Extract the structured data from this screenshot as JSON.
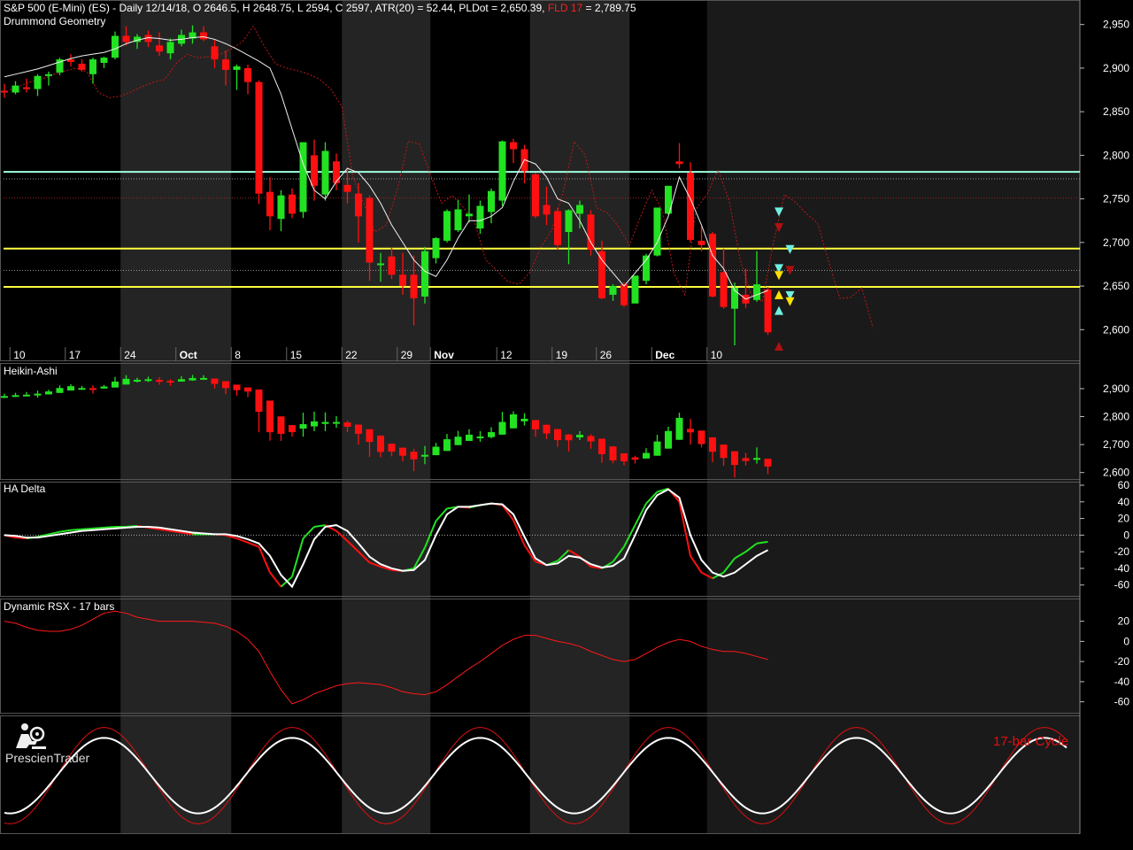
{
  "header": {
    "title": "S&P 500 (E-Mini) (ES) - Daily 12/14/18, O 2646.5, H 2648.75, L 2594, C 2597, ATR(20) = 52.44, PLDot = 2,650.39,",
    "fld_label": "FLD 17",
    "fld_value": "= 2,789.75"
  },
  "logo": {
    "text": "PrescienTrader",
    "icon": "prescientrader-logo-icon"
  },
  "colors": {
    "up": "#22e222",
    "down": "#ff1010",
    "hline_yellow": "#ffff40",
    "hline_cyan": "#9fffe0",
    "cycle_red": "#e01010",
    "band": "#242424"
  },
  "chart_data": [
    {
      "type": "candlestick",
      "title": "Drummond Geometry",
      "yticks": [
        2600,
        2650,
        2700,
        2750,
        2800,
        2850,
        2900,
        2950
      ],
      "ytick_labels": [
        "2,600",
        "2,650",
        "2,700",
        "2,750",
        "2,800",
        "2,850",
        "2,900",
        "2,950"
      ],
      "ylim": [
        2580,
        2970
      ],
      "xticks": [
        {
          "i": 1,
          "label": "10"
        },
        {
          "i": 6,
          "label": "17"
        },
        {
          "i": 11,
          "label": "24"
        },
        {
          "i": 16,
          "label": "Oct"
        },
        {
          "i": 21,
          "label": "8"
        },
        {
          "i": 26,
          "label": "15"
        },
        {
          "i": 31,
          "label": "22"
        },
        {
          "i": 36,
          "label": "29"
        },
        {
          "i": 39,
          "label": "Nov"
        },
        {
          "i": 45,
          "label": "12"
        },
        {
          "i": 50,
          "label": "19"
        },
        {
          "i": 54,
          "label": "26"
        },
        {
          "i": 59,
          "label": "Dec"
        },
        {
          "i": 64,
          "label": "10"
        }
      ],
      "candles": [
        [
          2874,
          2882,
          2866,
          2872
        ],
        [
          2872,
          2885,
          2870,
          2880
        ],
        [
          2878,
          2888,
          2872,
          2876
        ],
        [
          2876,
          2893,
          2868,
          2891
        ],
        [
          2891,
          2896,
          2880,
          2893
        ],
        [
          2895,
          2912,
          2892,
          2910
        ],
        [
          2910,
          2916,
          2902,
          2907
        ],
        [
          2905,
          2910,
          2896,
          2898
        ],
        [
          2893,
          2912,
          2882,
          2910
        ],
        [
          2906,
          2913,
          2900,
          2912
        ],
        [
          2912,
          2942,
          2910,
          2937
        ],
        [
          2937,
          2948,
          2926,
          2930
        ],
        [
          2930,
          2939,
          2922,
          2936
        ],
        [
          2938,
          2943,
          2924,
          2930
        ],
        [
          2926,
          2941,
          2914,
          2919
        ],
        [
          2917,
          2934,
          2910,
          2930
        ],
        [
          2928,
          2944,
          2925,
          2938
        ],
        [
          2934,
          2949,
          2928,
          2941
        ],
        [
          2941,
          2948,
          2931,
          2933
        ],
        [
          2925,
          2933,
          2900,
          2910
        ],
        [
          2910,
          2920,
          2880,
          2898
        ],
        [
          2898,
          2904,
          2875,
          2902
        ],
        [
          2900,
          2904,
          2870,
          2884
        ],
        [
          2884,
          2886,
          2744,
          2756
        ],
        [
          2758,
          2775,
          2714,
          2730
        ],
        [
          2727,
          2760,
          2713,
          2754
        ],
        [
          2755,
          2762,
          2728,
          2733
        ],
        [
          2735,
          2814,
          2728,
          2815
        ],
        [
          2800,
          2818,
          2748,
          2765
        ],
        [
          2755,
          2815,
          2748,
          2805
        ],
        [
          2793,
          2802,
          2760,
          2768
        ],
        [
          2766,
          2786,
          2745,
          2758
        ],
        [
          2756,
          2768,
          2700,
          2730
        ],
        [
          2751,
          2754,
          2656,
          2677
        ],
        [
          2676,
          2688,
          2655,
          2676
        ],
        [
          2684,
          2694,
          2658,
          2663
        ],
        [
          2663,
          2688,
          2640,
          2650
        ],
        [
          2663,
          2685,
          2605,
          2636
        ],
        [
          2638,
          2695,
          2630,
          2690
        ],
        [
          2682,
          2706,
          2676,
          2705
        ],
        [
          2702,
          2738,
          2700,
          2736
        ],
        [
          2714,
          2749,
          2712,
          2738
        ],
        [
          2730,
          2755,
          2723,
          2733
        ],
        [
          2716,
          2748,
          2710,
          2742
        ],
        [
          2735,
          2762,
          2722,
          2759
        ],
        [
          2748,
          2817,
          2742,
          2816
        ],
        [
          2815,
          2819,
          2791,
          2807
        ],
        [
          2807,
          2812,
          2768,
          2782
        ],
        [
          2778,
          2780,
          2728,
          2730
        ],
        [
          2743,
          2764,
          2720,
          2732
        ],
        [
          2736,
          2740,
          2692,
          2697
        ],
        [
          2712,
          2738,
          2675,
          2737
        ],
        [
          2733,
          2748,
          2716,
          2743
        ],
        [
          2732,
          2737,
          2685,
          2692
        ],
        [
          2690,
          2702,
          2635,
          2636
        ],
        [
          2640,
          2652,
          2633,
          2650
        ],
        [
          2652,
          2654,
          2626,
          2628
        ],
        [
          2630,
          2660,
          2632,
          2662
        ],
        [
          2656,
          2687,
          2652,
          2685
        ],
        [
          2685,
          2735,
          2684,
          2740
        ],
        [
          2733,
          2764,
          2732,
          2765
        ],
        [
          2793,
          2814,
          2785,
          2790
        ],
        [
          2780,
          2792,
          2700,
          2703
        ],
        [
          2702,
          2718,
          2690,
          2697
        ],
        [
          2710,
          2712,
          2637,
          2638
        ],
        [
          2666,
          2693,
          2624,
          2626
        ],
        [
          2624,
          2654,
          2582,
          2648
        ],
        [
          2640,
          2670,
          2625,
          2630
        ],
        [
          2634,
          2690,
          2632,
          2652
        ],
        [
          2646,
          2649,
          2594,
          2597
        ]
      ],
      "pldot": [
        2890,
        2893,
        2896,
        2899,
        2903,
        2907,
        2911,
        2914,
        2916,
        2918,
        2922,
        2928,
        2932,
        2935,
        2934,
        2932,
        2933,
        2935,
        2936,
        2933,
        2928,
        2922,
        2915,
        2908,
        2900,
        2870,
        2830,
        2790,
        2760,
        2750,
        2770,
        2785,
        2780,
        2765,
        2745,
        2720,
        2700,
        2680,
        2667,
        2661,
        2680,
        2705,
        2725,
        2725,
        2730,
        2740,
        2770,
        2795,
        2790,
        2775,
        2750,
        2745,
        2725,
        2700,
        2680,
        2665,
        2650,
        2665,
        2680,
        2700,
        2730,
        2775,
        2750,
        2720,
        2685,
        2670,
        2645,
        2635,
        2640,
        2645
      ],
      "fld": [
        2875,
        2880,
        2885,
        2888,
        2893,
        2897,
        2900,
        2895,
        2872,
        2866,
        2868,
        2873,
        2879,
        2884,
        2887,
        2905,
        2916,
        2912,
        2913,
        2916,
        2922,
        2930,
        2948,
        2925,
        2905,
        2900,
        2897,
        2893,
        2887,
        2876,
        2856,
        2775,
        2744,
        2712,
        2720,
        2760,
        2816,
        2813,
        2778,
        2745,
        2754,
        2740,
        2723,
        2680,
        2668,
        2655,
        2652,
        2666,
        2695,
        2715,
        2758,
        2816,
        2800,
        2740,
        2734,
        2718,
        2697,
        2730,
        2760,
        2735,
        2665,
        2640,
        2738,
        2755,
        2783,
        2748,
        2680,
        2640,
        2632,
        2700,
        2755,
        2746,
        2733,
        2722,
        2678,
        2636,
        2637,
        2648,
        2602
      ],
      "hlines": [
        {
          "value": 2781,
          "style": "cyan-solid"
        },
        {
          "value": 2773,
          "style": "grey-dotted"
        },
        {
          "value": 2751,
          "style": "red-dotted"
        },
        {
          "value": 2693,
          "style": "yellow-solid"
        },
        {
          "value": 2668,
          "style": "grey-dotted"
        },
        {
          "value": 2649,
          "style": "yellow-solid"
        }
      ],
      "markers": [
        {
          "i": 70,
          "y": 2735,
          "shape": "down-triangle",
          "color": "cyan"
        },
        {
          "i": 70,
          "y": 2717,
          "shape": "down-triangle",
          "color": "darkred"
        },
        {
          "i": 71,
          "y": 2692,
          "shape": "down-triangle",
          "color": "cyan"
        },
        {
          "i": 70,
          "y": 2670,
          "shape": "down-triangle",
          "color": "cyan"
        },
        {
          "i": 70,
          "y": 2662,
          "shape": "down-triangle",
          "color": "yellow"
        },
        {
          "i": 71,
          "y": 2668,
          "shape": "down-triangle",
          "color": "darkred"
        },
        {
          "i": 71,
          "y": 2639,
          "shape": "down-triangle",
          "color": "cyan"
        },
        {
          "i": 71,
          "y": 2632,
          "shape": "down-triangle",
          "color": "yellow"
        },
        {
          "i": 70,
          "y": 2640,
          "shape": "up-triangle",
          "color": "yellow"
        },
        {
          "i": 70,
          "y": 2622,
          "shape": "up-triangle",
          "color": "cyan"
        },
        {
          "i": 70,
          "y": 2581,
          "shape": "up-triangle",
          "color": "darkred"
        }
      ]
    },
    {
      "type": "candlestick",
      "title": "Heikin-Ashi",
      "yticks": [
        2600,
        2700,
        2800,
        2900
      ],
      "ytick_labels": [
        "2,600",
        "2,700",
        "2,800",
        "2,900"
      ],
      "ylim": [
        2580,
        2960
      ]
    },
    {
      "type": "line",
      "title": "HA Delta",
      "yticks": [
        60,
        40,
        20,
        0,
        -20,
        -40,
        -60
      ],
      "ytick_labels": [
        "60",
        "40",
        "20",
        "0",
        "-20",
        "-40",
        "-60"
      ],
      "ylim": [
        -72,
        60
      ],
      "series": [
        {
          "color": "bicolor",
          "values": [
            0,
            -3,
            -4,
            -2,
            1,
            4,
            6,
            7,
            8,
            9,
            10,
            10,
            11,
            9,
            7,
            5,
            3,
            1,
            1,
            1,
            0,
            -4,
            -9,
            -14,
            -45,
            -62,
            -50,
            -4,
            10,
            12,
            5,
            -7,
            -20,
            -33,
            -38,
            -42,
            -43,
            -40,
            -15,
            17,
            32,
            34,
            33,
            36,
            38,
            36,
            18,
            -12,
            -32,
            -36,
            -31,
            -18,
            -26,
            -38,
            -40,
            -32,
            -14,
            12,
            38,
            52,
            56,
            40,
            -25,
            -45,
            -52,
            -45,
            -28,
            -20,
            -10,
            -8
          ]
        },
        {
          "color": "#ffffff",
          "values": [
            0,
            -1,
            -3,
            -3,
            -1,
            1,
            3,
            5,
            6,
            7,
            8,
            9,
            10,
            10,
            9,
            7,
            5,
            3,
            2,
            1,
            1,
            -1,
            -5,
            -10,
            -25,
            -48,
            -62,
            -35,
            -5,
            10,
            12,
            5,
            -10,
            -26,
            -35,
            -40,
            -43,
            -42,
            -30,
            0,
            25,
            34,
            34,
            36,
            38,
            37,
            25,
            -2,
            -28,
            -36,
            -34,
            -25,
            -27,
            -35,
            -39,
            -37,
            -28,
            0,
            30,
            48,
            55,
            45,
            0,
            -30,
            -45,
            -50,
            -45,
            -35,
            -25,
            -18
          ]
        }
      ]
    },
    {
      "type": "line",
      "title": "Dynamic RSX - 17 bars",
      "yticks": [
        20,
        0,
        -20,
        -40,
        -60
      ],
      "ytick_labels": [
        "20",
        "0",
        "-20",
        "-40",
        "-60"
      ],
      "ylim": [
        -70,
        32
      ],
      "series": [
        {
          "color": "#ff1818",
          "values": [
            20,
            18,
            14,
            11,
            10,
            10,
            12,
            16,
            22,
            28,
            30,
            28,
            24,
            22,
            20,
            20,
            20,
            20,
            19,
            18,
            15,
            10,
            2,
            -10,
            -30,
            -48,
            -62,
            -58,
            -52,
            -48,
            -44,
            -42,
            -41,
            -42,
            -43,
            -46,
            -50,
            -52,
            -53,
            -50,
            -43,
            -35,
            -27,
            -20,
            -12,
            -4,
            2,
            6,
            6,
            3,
            0,
            -2,
            -5,
            -10,
            -14,
            -18,
            -20,
            -18,
            -12,
            -6,
            -1,
            2,
            0,
            -5,
            -8,
            -10,
            -10,
            -12,
            -15,
            -18
          ]
        }
      ]
    },
    {
      "type": "line",
      "title": "",
      "legend_text": "17-bar Cycle",
      "ylim": [
        -1.2,
        1.2
      ],
      "series": [
        {
          "color": "#ffffff",
          "period": 17,
          "amplitude": 0.8,
          "phase_peak_index": 9
        },
        {
          "color": "#e01010",
          "period": 17,
          "amplitude": 1.02,
          "phase_peak_index": 9
        }
      ]
    }
  ]
}
